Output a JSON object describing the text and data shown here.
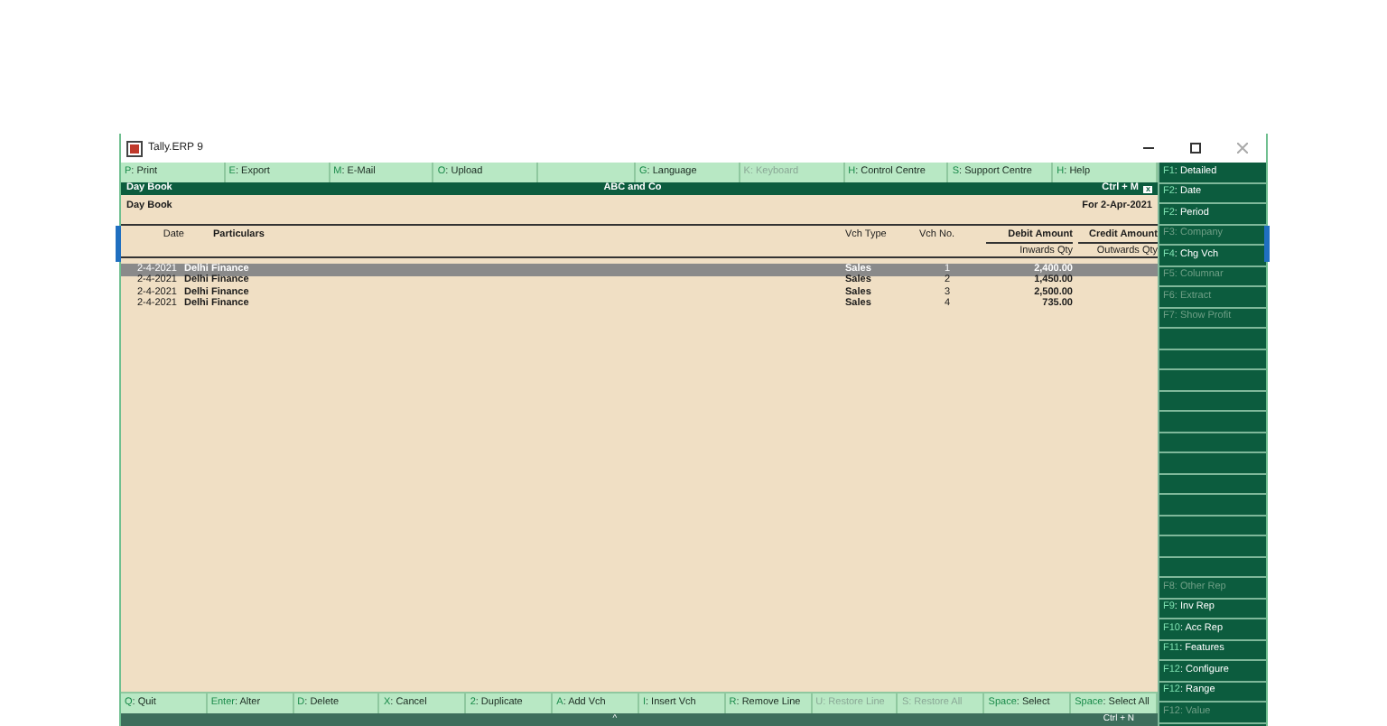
{
  "window": {
    "title": "Tally.ERP 9"
  },
  "top_buttons": [
    {
      "kind": "button",
      "key": "P",
      "label": ": Print",
      "disabled": false
    },
    {
      "kind": "button",
      "key": "E",
      "label": ": Export",
      "disabled": false
    },
    {
      "kind": "button",
      "key": "M",
      "label": ": E-Mail",
      "disabled": false
    },
    {
      "kind": "button",
      "key": "O",
      "label": ": Upload",
      "disabled": false
    },
    {
      "kind": "blank"
    },
    {
      "kind": "button",
      "key": "G",
      "label": ": Language",
      "disabled": false
    },
    {
      "kind": "button",
      "key": "K",
      "label": ": Keyboard",
      "disabled": true
    },
    {
      "kind": "button",
      "key": "H",
      "label": ": Control Centre",
      "disabled": false
    },
    {
      "kind": "button",
      "key": "S",
      "label": ": Support Centre",
      "disabled": false
    },
    {
      "kind": "button",
      "key": "H",
      "label": ": Help",
      "disabled": false
    }
  ],
  "header": {
    "title": "Day Book",
    "company": "ABC and Co",
    "shortcut": "Ctrl + M",
    "close": "x"
  },
  "report": {
    "name": "Day Book",
    "period": "For 2-Apr-2021"
  },
  "columns": {
    "date": "Date",
    "particulars": "Particulars",
    "vch_type": "Vch Type",
    "vch_no": "Vch No.",
    "debit": "Debit Amount",
    "debit_sub": "Inwards Qty",
    "credit": "Credit Amount",
    "credit_sub": "Outwards Qty"
  },
  "rows": [
    {
      "date": "2-4-2021",
      "particulars": "Delhi Finance",
      "vch_type": "Sales",
      "vch_no": "1",
      "debit": "2,400.00",
      "selected": true
    },
    {
      "date": "2-4-2021",
      "particulars": "Delhi Finance",
      "vch_type": "Sales",
      "vch_no": "2",
      "debit": "1,450.00",
      "selected": false
    },
    {
      "date": "2-4-2021",
      "particulars": "Delhi Finance",
      "vch_type": "Sales",
      "vch_no": "3",
      "debit": "2,500.00",
      "selected": false
    },
    {
      "date": "2-4-2021",
      "particulars": "Delhi Finance",
      "vch_type": "Sales",
      "vch_no": "4",
      "debit": "735.00",
      "selected": false
    }
  ],
  "sidebar": [
    {
      "kind": "button",
      "key": "F1",
      "label": ": Detailed",
      "disabled": false
    },
    {
      "kind": "button",
      "key": "F2",
      "label": ": Date",
      "disabled": false
    },
    {
      "kind": "button",
      "key": "F2",
      "label": ": Period",
      "disabled": false
    },
    {
      "kind": "button",
      "key": "F3",
      "label": ": Company",
      "disabled": true
    },
    {
      "kind": "button",
      "key": "F4",
      "label": ": Chg Vch",
      "disabled": false
    },
    {
      "kind": "button",
      "key": "F5",
      "label": ": Columnar",
      "disabled": true
    },
    {
      "kind": "button",
      "key": "F6",
      "label": ": Extract",
      "disabled": true
    },
    {
      "kind": "button",
      "key": "F7",
      "label": ": Show Profit",
      "disabled": true
    },
    {
      "kind": "blank"
    },
    {
      "kind": "blank"
    },
    {
      "kind": "blank"
    },
    {
      "kind": "blank"
    },
    {
      "kind": "blank"
    },
    {
      "kind": "blank"
    },
    {
      "kind": "blank"
    },
    {
      "kind": "blank"
    },
    {
      "kind": "blank"
    },
    {
      "kind": "blank"
    },
    {
      "kind": "blank"
    },
    {
      "kind": "blank"
    },
    {
      "kind": "button",
      "key": "F8",
      "label": ": Other Rep",
      "disabled": true
    },
    {
      "kind": "button",
      "key": "F9",
      "label": ": Inv Rep",
      "disabled": false
    },
    {
      "kind": "button",
      "key": "F10",
      "label": ": Acc Rep",
      "disabled": false
    },
    {
      "kind": "button",
      "key": "F11",
      "label": ": Features",
      "disabled": false
    },
    {
      "kind": "button",
      "key": "F12",
      "label": ": Configure",
      "disabled": false
    },
    {
      "kind": "button",
      "key": "F12",
      "label": ": Range",
      "disabled": false
    },
    {
      "kind": "button",
      "key": "F12",
      "label": ": Value",
      "disabled": true
    }
  ],
  "bottom_buttons": [
    {
      "key": "Q",
      "label": ": Quit",
      "disabled": false
    },
    {
      "key": "Enter",
      "label": ": Alter",
      "disabled": false
    },
    {
      "key": "D",
      "label": ": Delete",
      "disabled": false
    },
    {
      "key": "X",
      "label": ": Cancel",
      "disabled": false
    },
    {
      "key": "2",
      "label": ": Duplicate",
      "disabled": false
    },
    {
      "key": "A",
      "label": ": Add Vch",
      "disabled": false
    },
    {
      "key": "I",
      "label": ": Insert Vch",
      "disabled": false
    },
    {
      "key": "R",
      "label": ": Remove Line",
      "disabled": false
    },
    {
      "key": "U",
      "label": ": Restore Line",
      "disabled": true
    },
    {
      "key": "S",
      "label": ": Restore All",
      "disabled": true
    },
    {
      "key": "Space",
      "label": ": Select",
      "disabled": false
    },
    {
      "key": "Space",
      "label": ": Select All",
      "disabled": false
    }
  ],
  "footer": {
    "more": "^",
    "shortcut": "Ctrl + N"
  }
}
